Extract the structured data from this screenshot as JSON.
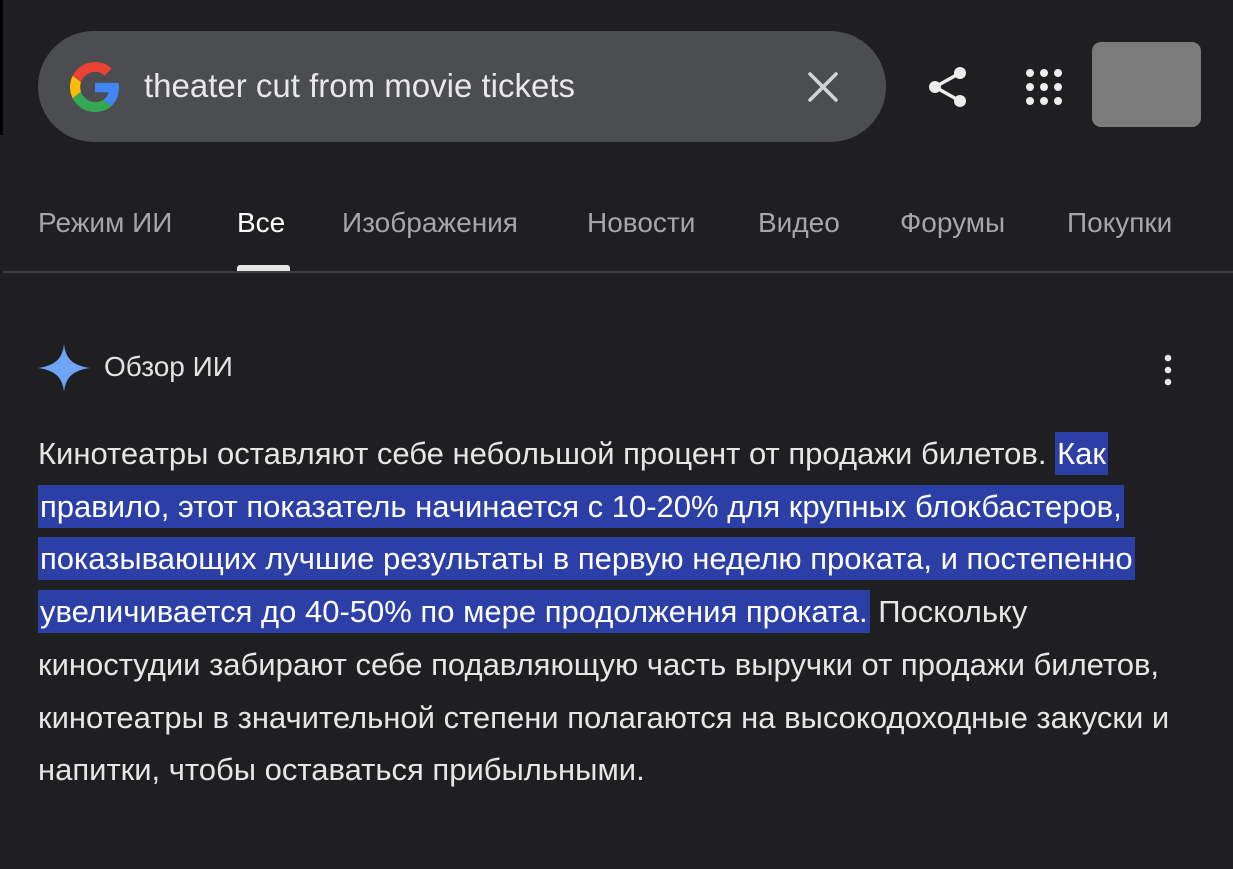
{
  "search": {
    "query": "theater cut from movie tickets"
  },
  "tabs": [
    {
      "label": "Режим ИИ",
      "active": false
    },
    {
      "label": "Все",
      "active": true
    },
    {
      "label": "Изображения",
      "active": false
    },
    {
      "label": "Новости",
      "active": false
    },
    {
      "label": "Видео",
      "active": false
    },
    {
      "label": "Форумы",
      "active": false
    },
    {
      "label": "Покупки",
      "active": false
    }
  ],
  "ai_overview": {
    "title": "Обзор ИИ",
    "text_before": "Кинотеатры оставляют себе небольшой процент от продажи билетов.",
    "text_highlighted": "Как правило, этот показатель начинается с 10-20% для крупных блокбастеров, показывающих лучшие результаты в первую неделю проката, и постепенно увеличивается до 40-50% по мере продолжения проката.",
    "text_after": "Поскольку киностудии забирают себе подавляющую часть выручки от продажи билетов, кинотеатры в значительной степени полагаются на высокодоходные закуски и напитки, чтобы оставаться прибыльными."
  },
  "colors": {
    "background": "#1f1f21",
    "search_bar": "#4c4d51",
    "highlight": "#2b3fa6",
    "sparkle": "#6fa3f6"
  },
  "icons": {
    "logo": "google-g-icon",
    "clear": "close-icon",
    "share": "share-icon",
    "apps": "apps-grid-icon",
    "ai": "sparkle-icon",
    "more": "more-vert-icon"
  }
}
